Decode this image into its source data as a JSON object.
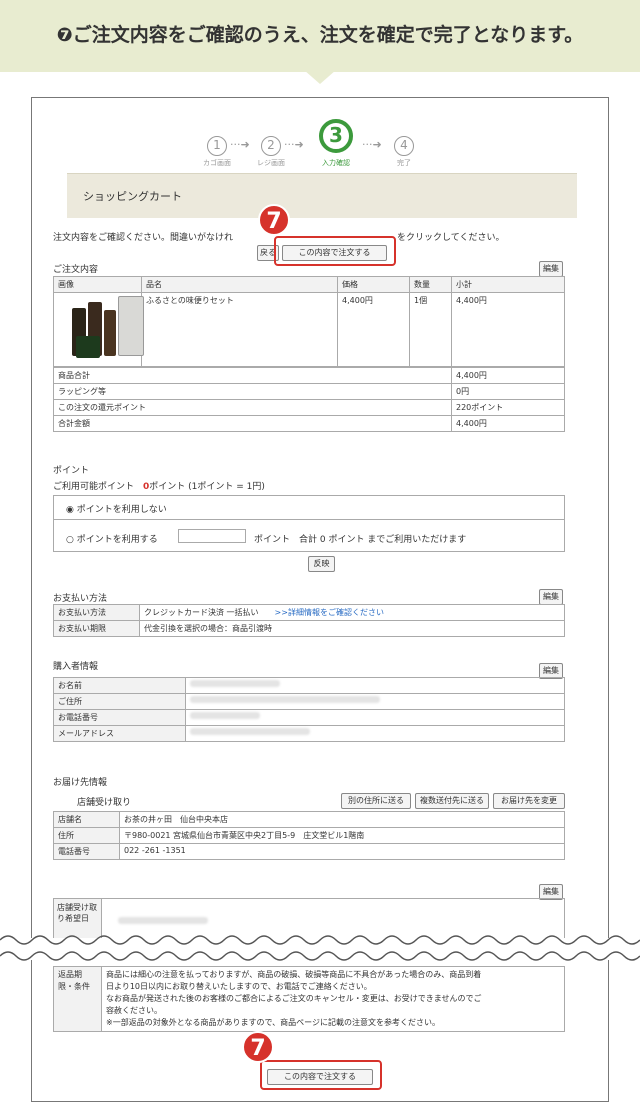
{
  "banner": {
    "num": "❼",
    "text": "ご注文内容をご確認のうえ、注文を確定で完了となります。"
  },
  "steps": [
    {
      "n": "1",
      "label": "カゴ画面"
    },
    {
      "n": "2",
      "label": "レジ画面"
    },
    {
      "n": "3",
      "label": "入力確認"
    },
    {
      "n": "4",
      "label": "完了"
    }
  ],
  "cart": {
    "title": "ショッピングカート",
    "notice_a": "注文内容をご確認ください。間違いがなけれ",
    "notice_b": "をクリックしてください。",
    "back": "戻る",
    "order": "この内容で注文する"
  },
  "badge": "7",
  "order": {
    "title": "ご注文内容",
    "edit": "編集",
    "headers": [
      "画像",
      "品名",
      "価格",
      "数量",
      "小計"
    ],
    "item": {
      "name": "ふるさとの味便りセット",
      "price": "4,400円",
      "qty": "1個",
      "subtotal": "4,400円"
    },
    "summary": [
      {
        "label": "商品合計",
        "value": "4,400円"
      },
      {
        "label": "ラッピング等",
        "value": "0円"
      },
      {
        "label": "この注文の還元ポイント",
        "value": "220ポイント"
      },
      {
        "label": "合計金額",
        "value": "4,400円"
      }
    ]
  },
  "points": {
    "title": "ポイント",
    "available_label": "ご利用可能ポイント",
    "available_value": "0",
    "available_unit": "ポイント (1ポイント = 1円)",
    "opt1": "ポイントを利用しない",
    "opt2": "ポイントを利用する",
    "opt2_suffix": "ポイント　合計 0 ポイント までご利用いただけます",
    "reflect": "反映"
  },
  "payment": {
    "title": "お支払い方法",
    "edit": "編集",
    "rows": [
      {
        "label": "お支払い方法",
        "value": "クレジットカード決済 一括払い",
        "link": ">>詳細情報をご確認ください"
      },
      {
        "label": "お支払い期限",
        "value": "代金引換を選択の場合：商品引渡時"
      }
    ]
  },
  "buyer": {
    "title": "購入者情報",
    "edit": "編集",
    "rows": [
      "お名前",
      "ご住所",
      "お電話番号",
      "メールアドレス"
    ]
  },
  "delivery": {
    "title": "お届け先情報",
    "sub": "店舗受け取り",
    "btn1": "別の住所に送る",
    "btn2": "複数送付先に送る",
    "btn3": "お届け先を変更",
    "rows": [
      {
        "label": "店舗名",
        "value": "お茶の井ヶ田　仙台中央本店"
      },
      {
        "label": "住所",
        "value": "〒980-0021 宮城県仙台市青葉区中央2丁目5-9　庄文堂ビル1階南"
      },
      {
        "label": "電話番号",
        "value": "022 -261 -1351"
      }
    ]
  },
  "store_pickup": {
    "edit": "編集",
    "label": "店舗受け取り希望日"
  },
  "returns": {
    "label": "返品期限・条件",
    "lines": [
      "商品には細心の注意を払っておりますが、商品の破損、破損等商品に不具合があった場合のみ、商品到着",
      "日より10日以内にお取り替えいたしますので、お電話でご連絡ください。",
      "なお商品が発送された後のお客様のご都合によるご注文のキャンセル・変更は、お受けできませんのでご",
      "容赦ください。",
      "※一部返品の対象外となる商品がありますので、商品ページに記載の注意文を参考ください。"
    ]
  },
  "order_bottom": "この内容で注文する"
}
